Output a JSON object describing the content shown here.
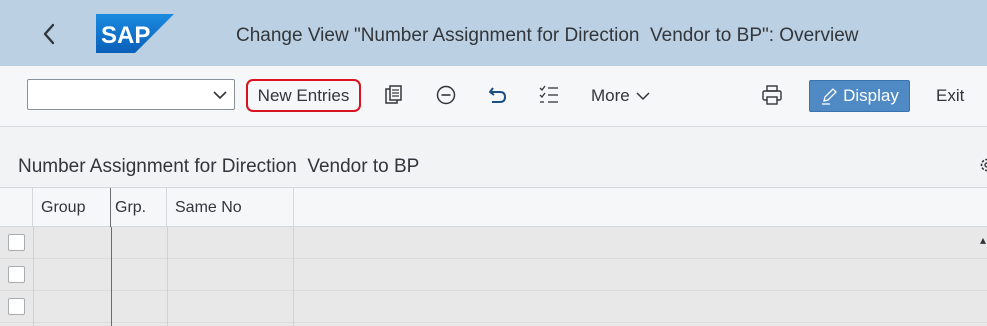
{
  "shell": {
    "title": "Change View \"Number Assignment for Direction  Vendor to BP\": Overview",
    "logo_text": "SAP"
  },
  "toolbar": {
    "combo_value": "",
    "new_entries": "New Entries",
    "more": "More",
    "display": "Display",
    "exit": "Exit",
    "icons": [
      "copy-icon",
      "delete-icon",
      "undo-icon",
      "select-all-icon",
      "print-icon",
      "edit-icon"
    ]
  },
  "section": {
    "title": "Number Assignment for Direction  Vendor to BP"
  },
  "table": {
    "columns": [
      "Group",
      "Grp.",
      "Same No"
    ],
    "rows": [
      {
        "group": "",
        "grp": "",
        "same_no": ""
      },
      {
        "group": "",
        "grp": "",
        "same_no": ""
      },
      {
        "group": "",
        "grp": "",
        "same_no": ""
      }
    ]
  },
  "colors": {
    "shell_bg": "#bcd0e4",
    "accent": "#4f8ac5",
    "highlight_border": "#d8121e",
    "sap_blue": "#0a6ed1"
  }
}
